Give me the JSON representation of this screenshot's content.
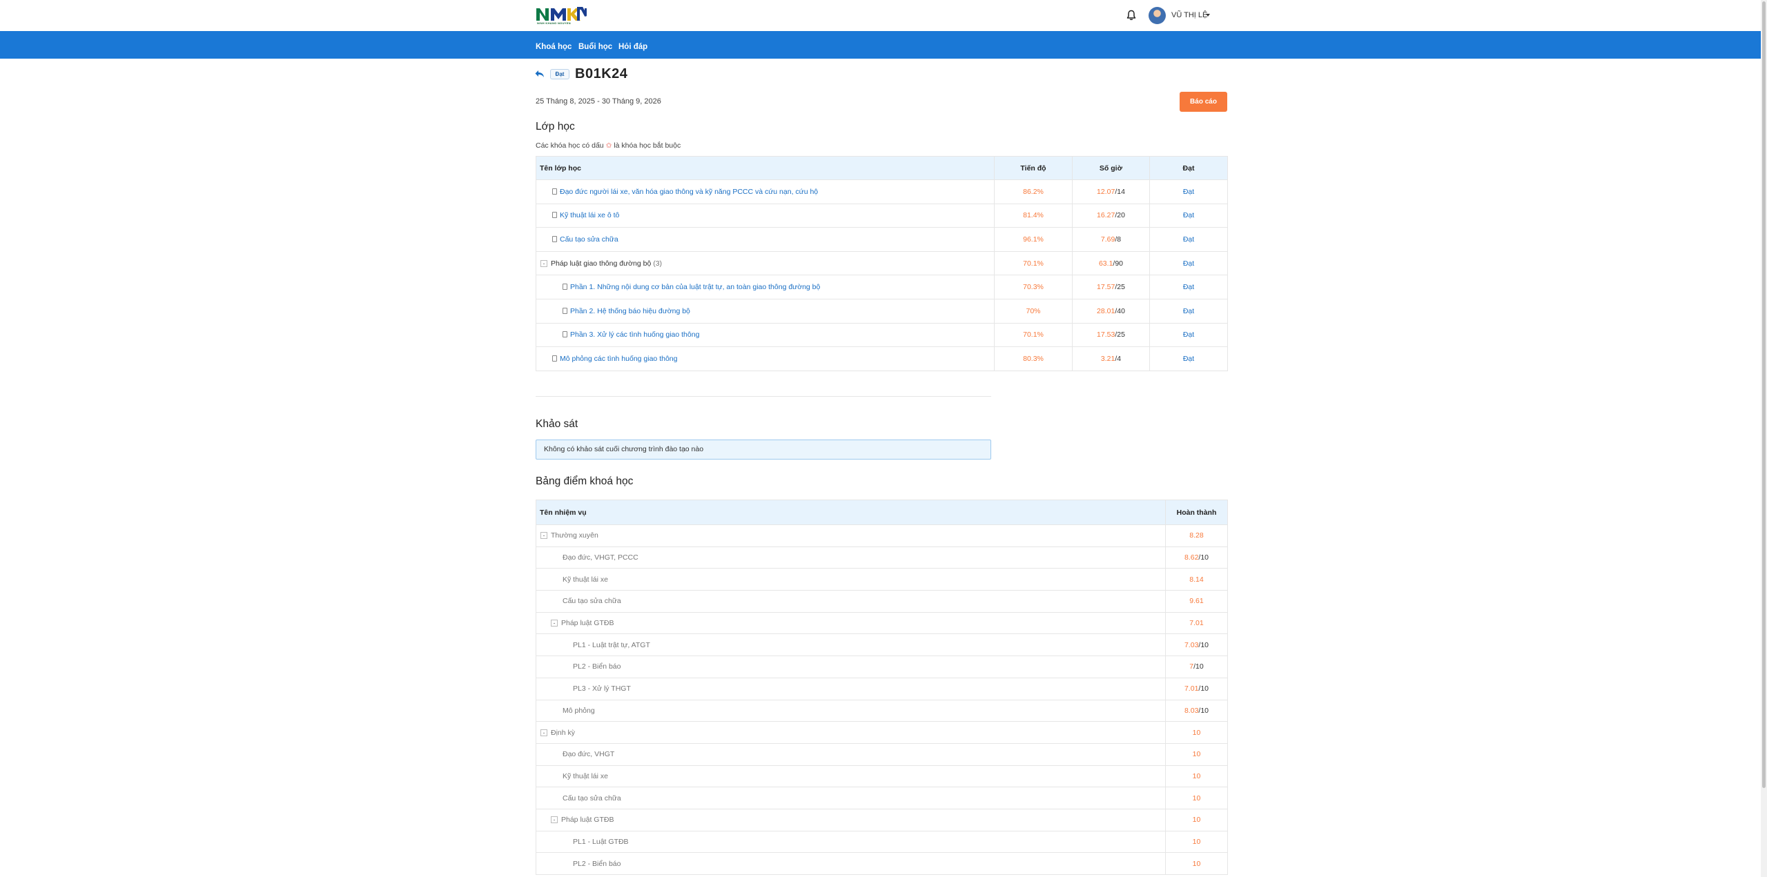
{
  "header": {
    "logo_sub": "NINH KHANG NGUYEN",
    "username": "VŨ THỊ LỆ"
  },
  "nav": [
    "Khoá học",
    "Buổi học",
    "Hỏi đáp"
  ],
  "course": {
    "status_badge": "Đạt",
    "code": "B01K24",
    "date_range": "25 Tháng 8, 2025 - 30 Tháng 9, 2026",
    "report_button": "Báo cáo"
  },
  "classes": {
    "title": "Lớp học",
    "note_before": "Các khóa học có dấu",
    "note_star": "✩",
    "note_after": "là khóa học bắt buộc",
    "headers": [
      "Tên lớp học",
      "Tiến độ",
      "Số giờ",
      "Đạt"
    ],
    "rows": [
      {
        "name": "Đạo đức người lái xe, văn hóa giao thông và kỹ năng PCCC và cứu nạn, cứu hộ",
        "progress": "86.2%",
        "hours": "12.07",
        "total": "/14",
        "result": "Đạt"
      },
      {
        "name": "Kỹ thuật lái xe ô tô",
        "progress": "81.4%",
        "hours": "16.27",
        "total": "/20",
        "result": "Đạt"
      },
      {
        "name": "Cấu tạo sửa chữa",
        "progress": "96.1%",
        "hours": "7.69",
        "total": "/8",
        "result": "Đạt"
      },
      {
        "name": "Pháp luật giao thông đường bộ",
        "count": "(3)",
        "progress": "70.1%",
        "hours": "63.1",
        "total": "/90",
        "result": "Đạt"
      },
      {
        "name": "Phần 1. Những nội dung cơ bản của luật trật tự, an toàn giao thông đường bộ",
        "progress": "70.3%",
        "hours": "17.57",
        "total": "/25",
        "result": "Đạt"
      },
      {
        "name": "Phần 2. Hệ thống báo hiệu đường bộ",
        "progress": "70%",
        "hours": "28.01",
        "total": "/40",
        "result": "Đạt"
      },
      {
        "name": "Phần 3. Xử lý các tình huống giao thông",
        "progress": "70.1%",
        "hours": "17.53",
        "total": "/25",
        "result": "Đạt"
      },
      {
        "name": "Mô phỏng các tình huống giao thông",
        "progress": "80.3%",
        "hours": "3.21",
        "total": "/4",
        "result": "Đạt"
      }
    ]
  },
  "survey": {
    "title": "Khảo sát",
    "message": "Không có khảo sát cuối chương trình đào tạo nào"
  },
  "grades": {
    "title": "Bảng điểm khoá học",
    "headers": [
      "Tên nhiệm vụ",
      "Hoàn thành"
    ],
    "rows": [
      {
        "name": "Thường xuyên",
        "score": "8.28",
        "total": ""
      },
      {
        "name": "Đạo đức, VHGT, PCCC",
        "score": "8.62",
        "total": "/10"
      },
      {
        "name": "Kỹ thuật lái xe",
        "score": "8.14",
        "total": ""
      },
      {
        "name": "Cấu tạo sửa chữa",
        "score": "9.61",
        "total": ""
      },
      {
        "name": "Pháp luật GTĐB",
        "score": "7.01",
        "total": ""
      },
      {
        "name": "PL1 - Luật trật tự, ATGT",
        "score": "7.03",
        "total": "/10"
      },
      {
        "name": "PL2 - Biển báo",
        "score": "7",
        "total": "/10"
      },
      {
        "name": "PL3 - Xử lý THGT",
        "score": "7.01",
        "total": "/10"
      },
      {
        "name": "Mô phỏng",
        "score": "8.03",
        "total": "/10"
      },
      {
        "name": "Định kỳ",
        "score": "10",
        "total": ""
      },
      {
        "name": "Đạo đức, VHGT",
        "score": "10",
        "total": ""
      },
      {
        "name": "Kỹ thuật lái xe",
        "score": "10",
        "total": ""
      },
      {
        "name": "Cấu tạo sửa chữa",
        "score": "10",
        "total": ""
      },
      {
        "name": "Pháp luật GTĐB",
        "score": "10",
        "total": ""
      },
      {
        "name": "PL1 - Luật GTĐB",
        "score": "10",
        "total": ""
      },
      {
        "name": "PL2 - Biển báo",
        "score": "10",
        "total": ""
      }
    ]
  },
  "colors": {
    "nav_bg": "#1a78d6",
    "accent_orange": "#f7793b",
    "link_blue": "#1a6fc4",
    "header_row_bg": "#e7f3fd"
  }
}
